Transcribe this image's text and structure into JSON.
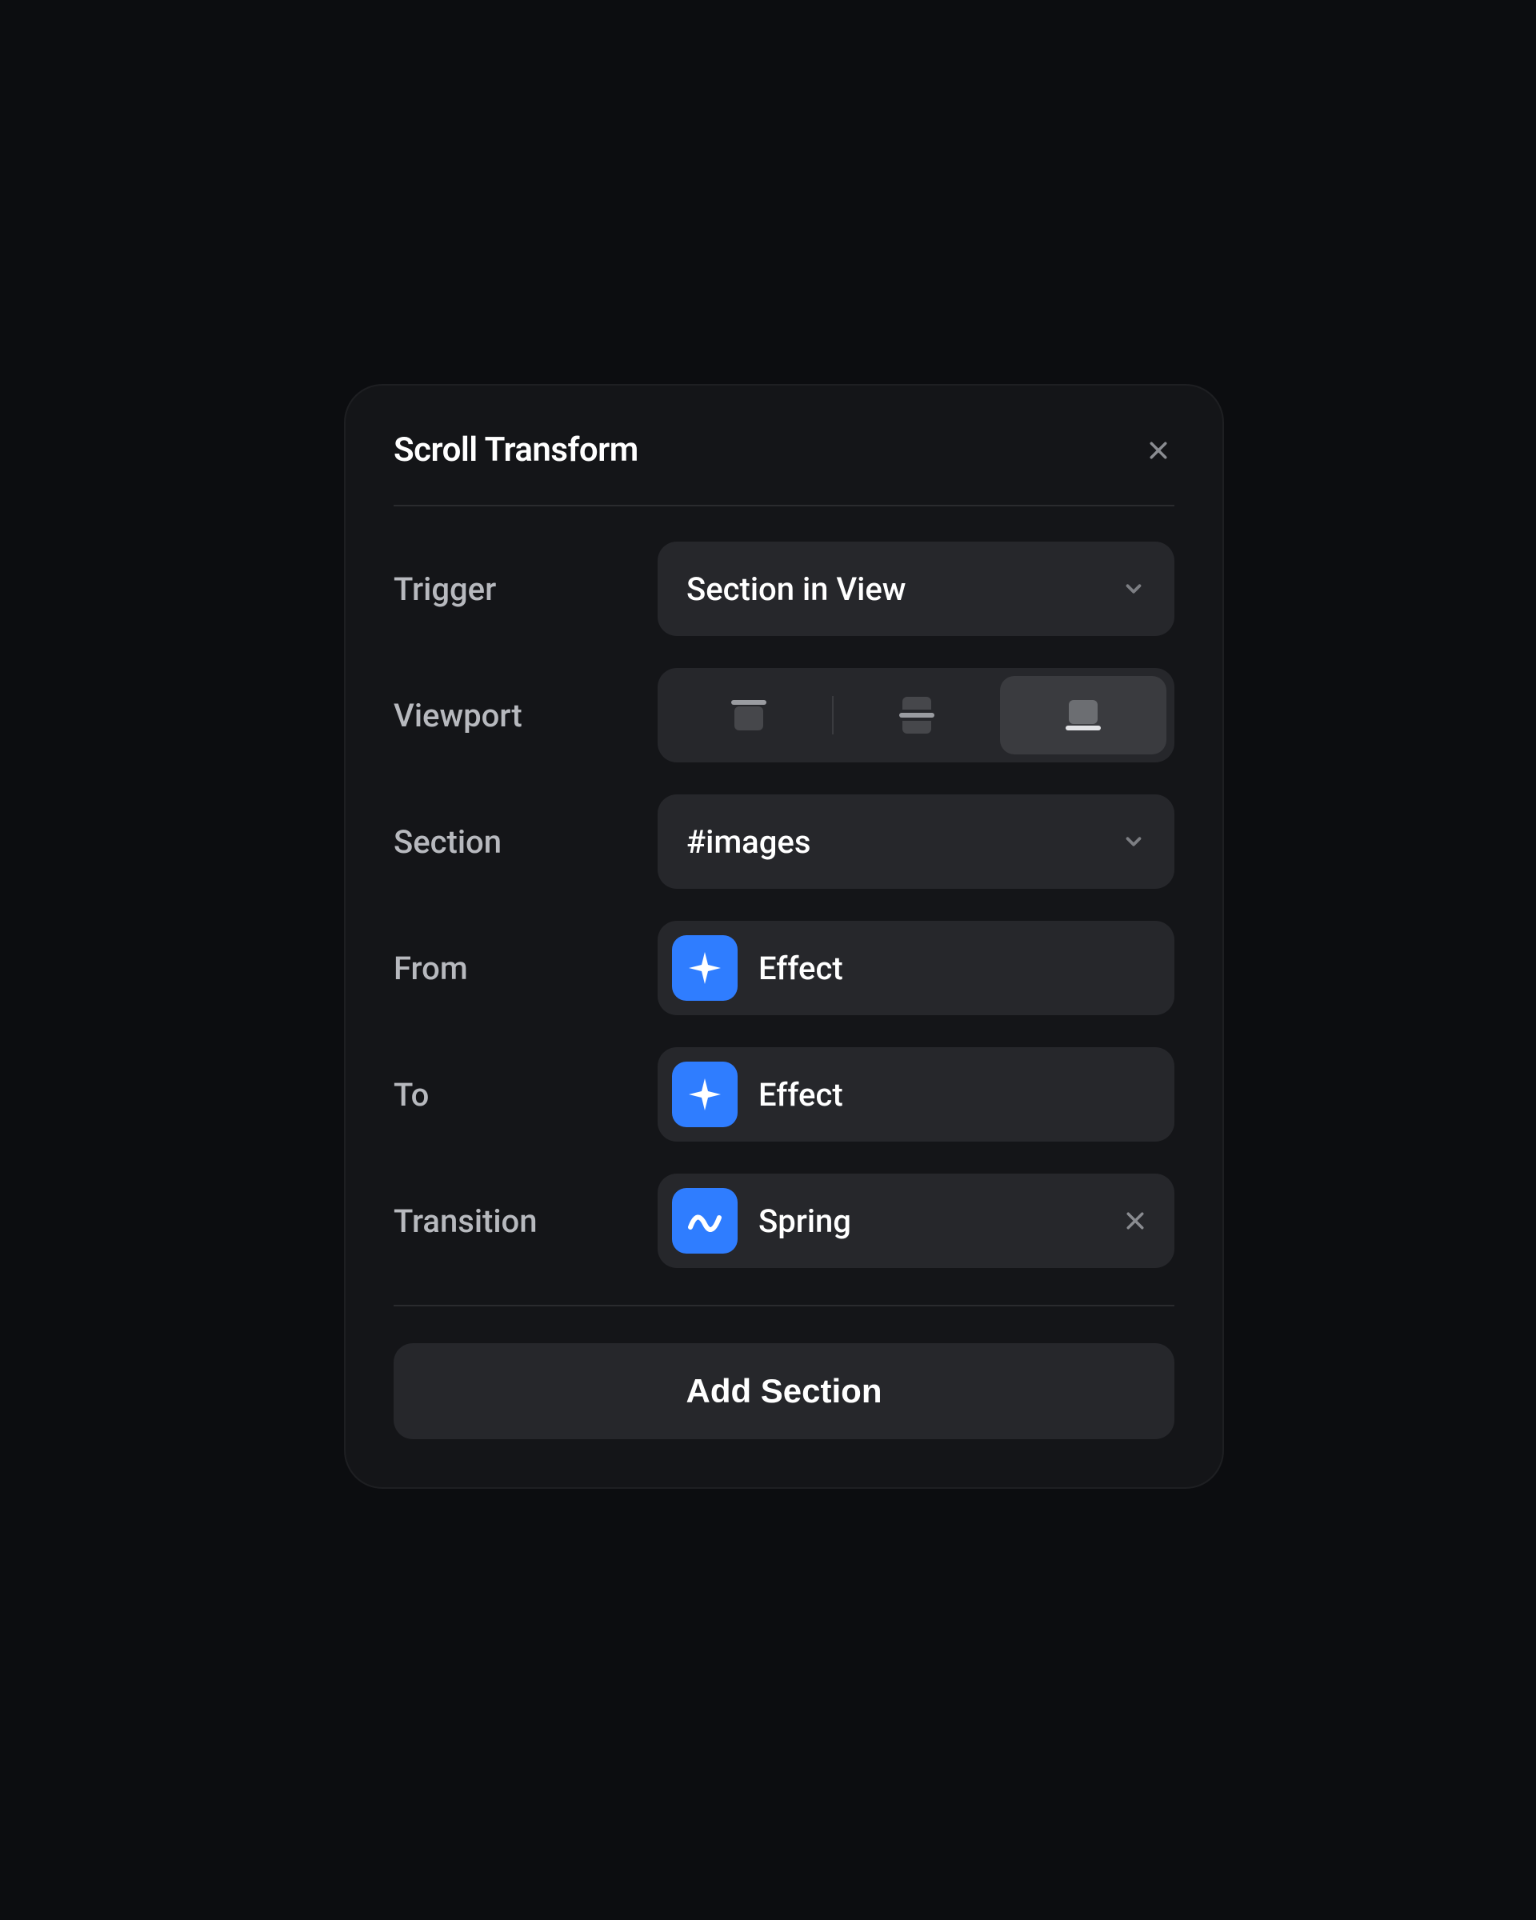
{
  "panel": {
    "title": "Scroll Transform",
    "labels": {
      "trigger": "Trigger",
      "viewport": "Viewport",
      "section": "Section",
      "from": "From",
      "to": "To",
      "transition": "Transition"
    },
    "values": {
      "trigger": "Section in View",
      "section": "#images",
      "from_effect": "Effect",
      "to_effect": "Effect",
      "transition": "Spring"
    },
    "viewport_selected": "bottom",
    "add_button": "Add Section"
  },
  "icons": {
    "close": "close-icon",
    "chevron_down": "chevron-down-icon",
    "sparkle": "sparkle-icon",
    "wave": "wave-icon",
    "remove": "close-small-icon",
    "viewport_top": "viewport-top-icon",
    "viewport_middle": "viewport-middle-icon",
    "viewport_bottom": "viewport-bottom-icon"
  },
  "colors": {
    "bg": "#0c0d10",
    "panel": "#141518",
    "control": "#26272b",
    "accent": "#2f7dff",
    "text": "#ffffff",
    "muted": "#b7b9be"
  }
}
